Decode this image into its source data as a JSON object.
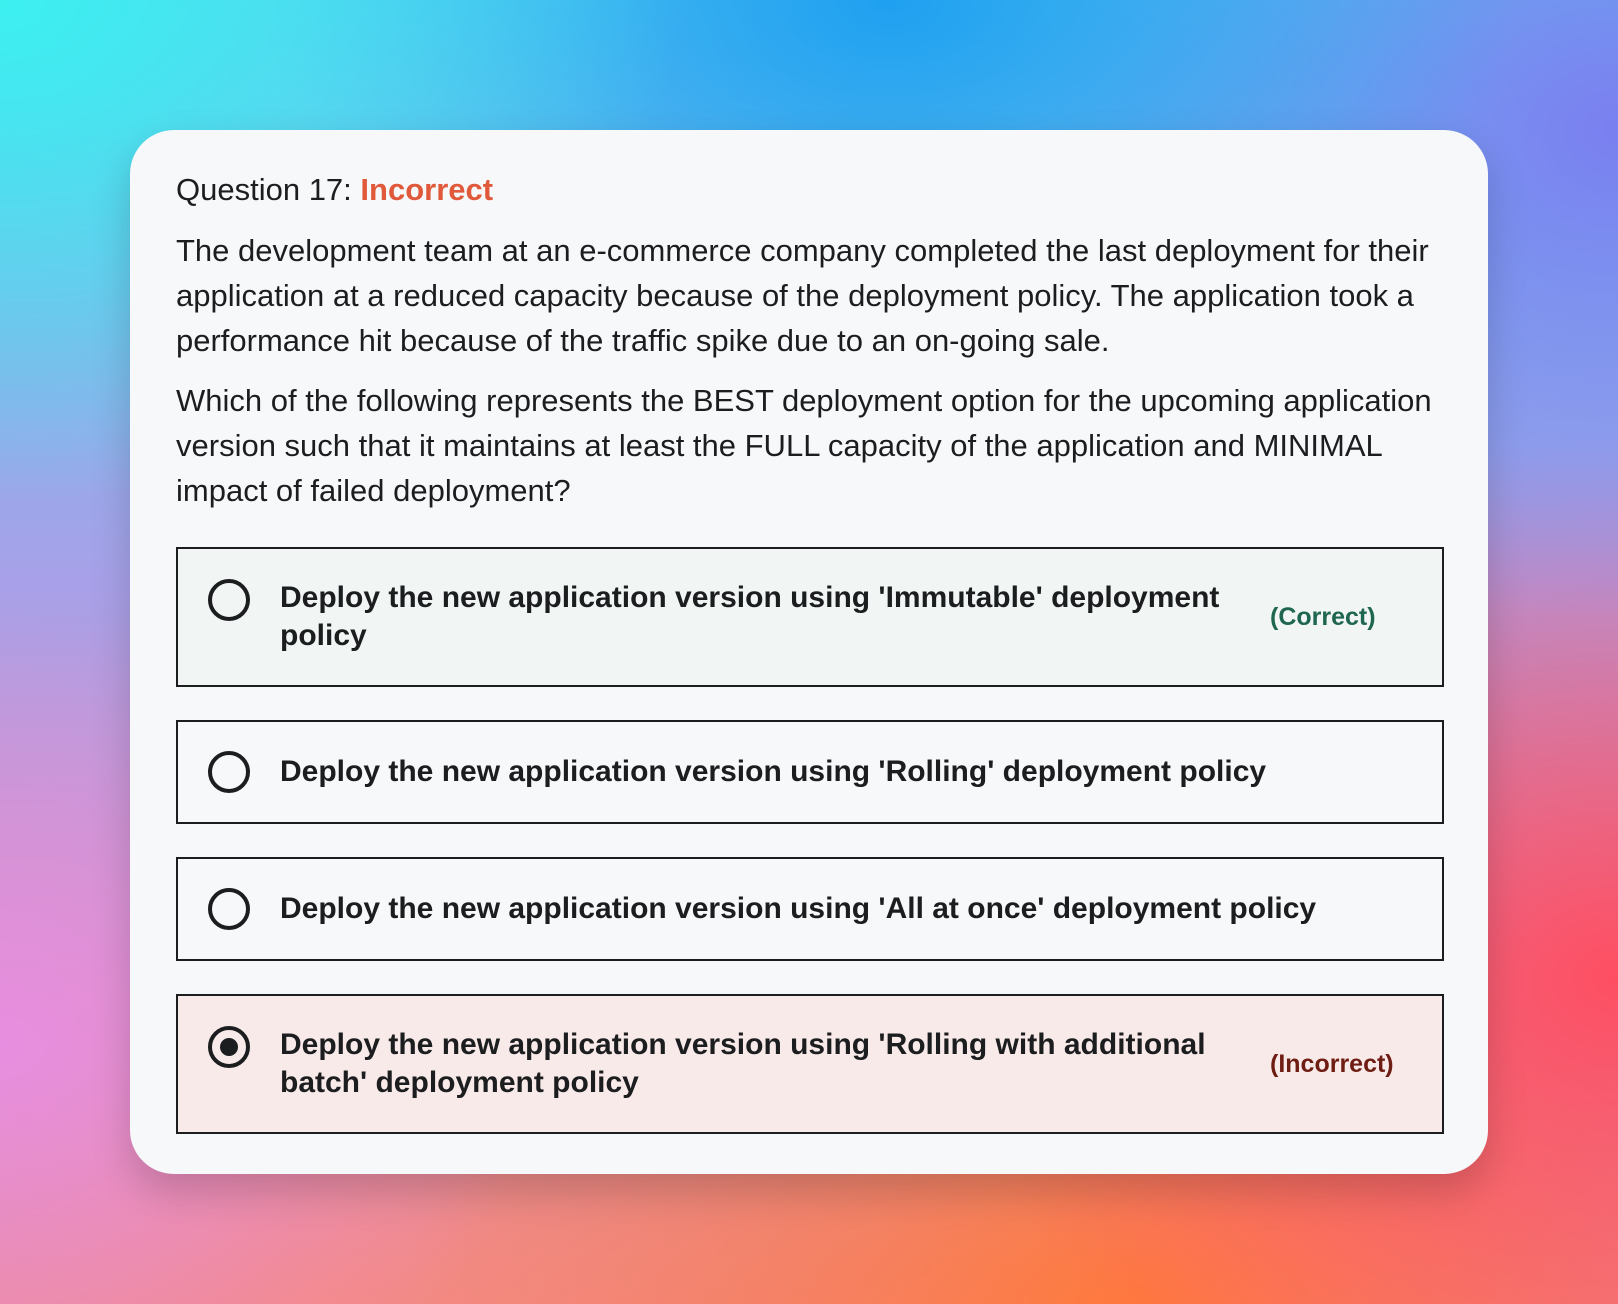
{
  "question": {
    "label": "Question 17:",
    "status": "Incorrect",
    "status_color": "#e0593a",
    "paragraphs": [
      "The development team at an e-commerce company completed the last deployment for their application at a reduced capacity because of the deployment policy. The application took a performance hit because of the traffic spike due to an on-going sale.",
      "Which of the following represents the BEST deployment option for the upcoming application version such that it maintains at least the FULL capacity of the application and MINIMAL impact of failed deployment?"
    ]
  },
  "options": [
    {
      "text": "Deploy the new application version using 'Immutable' deployment policy",
      "selected": false,
      "feedback": "(Correct)",
      "feedback_color": "#1e6650"
    },
    {
      "text": "Deploy the new application version using 'Rolling' deployment policy",
      "selected": false,
      "feedback": ""
    },
    {
      "text": "Deploy the new application version using 'All at once' deployment policy",
      "selected": false,
      "feedback": ""
    },
    {
      "text": "Deploy the new application version using 'Rolling with additional batch' deployment policy",
      "selected": true,
      "feedback": "(Incorrect)",
      "feedback_color": "#6e1d12"
    }
  ]
}
